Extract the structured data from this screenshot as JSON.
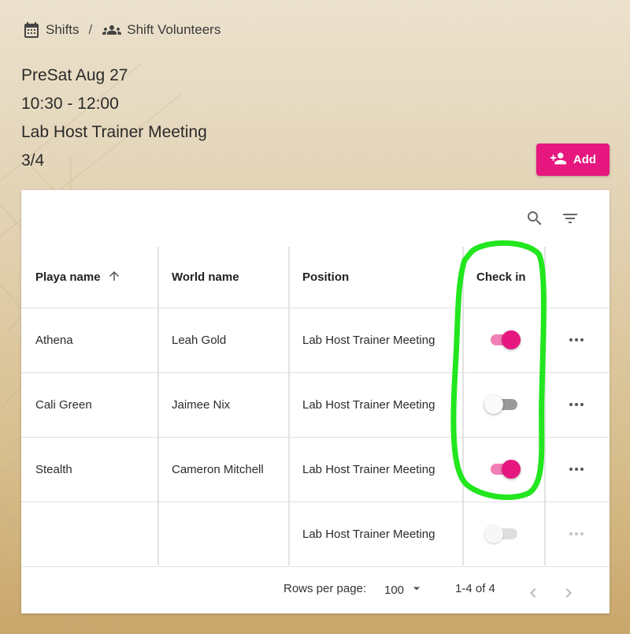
{
  "breadcrumb": {
    "shifts_label": "Shifts",
    "separator": "/",
    "volunteers_label": "Shift Volunteers"
  },
  "shift": {
    "date": "PreSat Aug 27",
    "time": "10:30 - 12:00",
    "name": "Lab Host Trainer Meeting",
    "filled": "3/4"
  },
  "add_button_label": "Add",
  "table": {
    "columns": [
      "Playa name",
      "World name",
      "Position",
      "Check in"
    ],
    "rows": [
      {
        "playa": "Athena",
        "world": "Leah Gold",
        "position": "Lab Host Trainer Meeting",
        "checked_in": true
      },
      {
        "playa": "Cali Green",
        "world": "Jaimee Nix",
        "position": "Lab Host Trainer Meeting",
        "checked_in": false
      },
      {
        "playa": "Stealth",
        "world": "Cameron Mitchell",
        "position": "Lab Host Trainer Meeting",
        "checked_in": true
      },
      {
        "playa": "",
        "world": "",
        "position": "Lab Host Trainer Meeting",
        "checked_in": false
      }
    ]
  },
  "pagination": {
    "rows_per_page_label": "Rows per page:",
    "rows_per_page_value": "100",
    "range": "1-4 of 4"
  },
  "colors": {
    "accent": "#e6177f",
    "highlight": "#22e61e"
  },
  "icons": [
    "calendar-icon",
    "people-icon",
    "add-person-icon",
    "search-icon",
    "filter-icon",
    "sort-arrow-up-icon",
    "more-horizontal-icon",
    "chevron-left-icon",
    "chevron-right-icon",
    "dropdown-arrow-icon"
  ]
}
